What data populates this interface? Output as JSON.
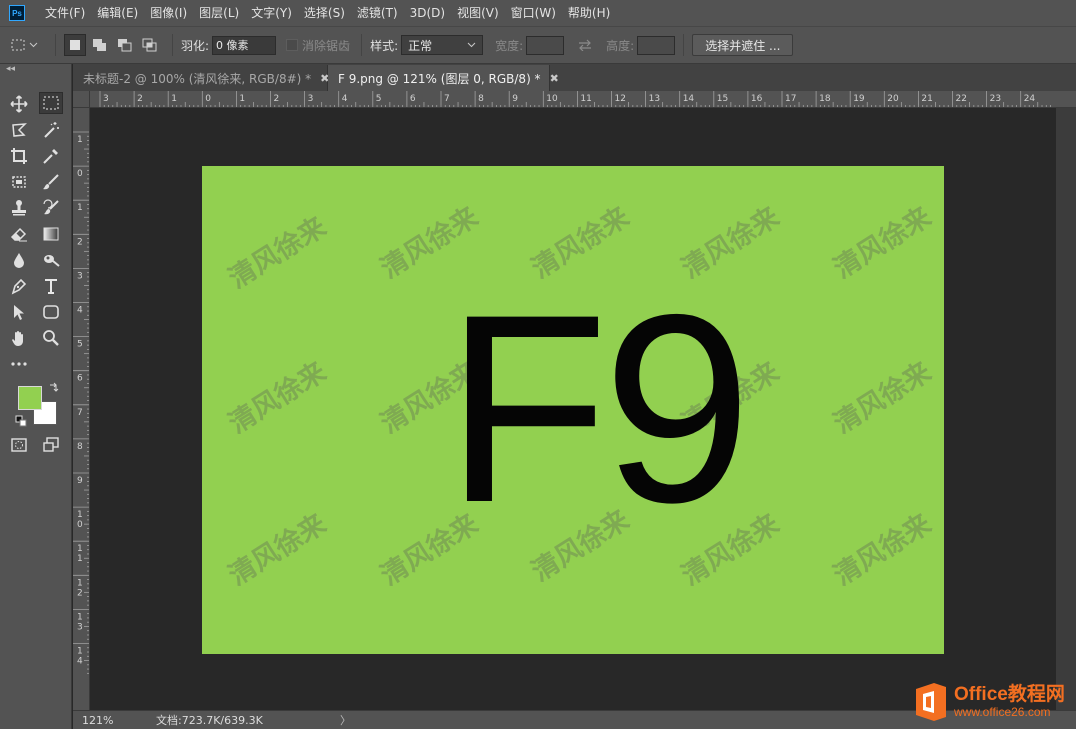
{
  "app": {
    "logo": "Ps"
  },
  "menu": [
    "文件(F)",
    "编辑(E)",
    "图像(I)",
    "图层(L)",
    "文字(Y)",
    "选择(S)",
    "滤镜(T)",
    "3D(D)",
    "视图(V)",
    "窗口(W)",
    "帮助(H)"
  ],
  "options": {
    "feather_label": "羽化:",
    "feather_value": "0 像素",
    "antialias_label": "消除锯齿",
    "style_label": "样式:",
    "style_value": "正常",
    "width_label": "宽度:",
    "height_label": "高度:",
    "select_mask_button": "选择并遮住 ..."
  },
  "tabs": [
    {
      "label": "未标题-2 @ 100% (清风徐来, RGB/8#) *",
      "active": false
    },
    {
      "label": "F 9.png @ 121% (图层 0, RGB/8) *",
      "active": true
    }
  ],
  "ruler": {
    "top_labels": [
      "3",
      "2",
      "1",
      "0",
      "1",
      "2",
      "3",
      "4",
      "5",
      "6",
      "7",
      "8",
      "9",
      "10",
      "11",
      "12",
      "13",
      "14",
      "15",
      "16",
      "17",
      "18",
      "19",
      "20",
      "21",
      "22",
      "23",
      "24"
    ],
    "left_labels": [
      "1",
      "0",
      "1",
      "2",
      "3",
      "4",
      "5",
      "6",
      "7",
      "8",
      "9",
      "10",
      "11",
      "12",
      "13",
      "14"
    ]
  },
  "colors": {
    "foreground": "#92d050",
    "background": "#ffffff",
    "document_fill": "#92d050"
  },
  "document": {
    "main_text": "F9",
    "watermark_text": "清风徐来"
  },
  "status": {
    "zoom": "121%",
    "doc_info": "文档:723.7K/639.3K",
    "arrow": "〉"
  },
  "site_logo": {
    "name": "Office教程网",
    "url": "www.office26.com"
  }
}
